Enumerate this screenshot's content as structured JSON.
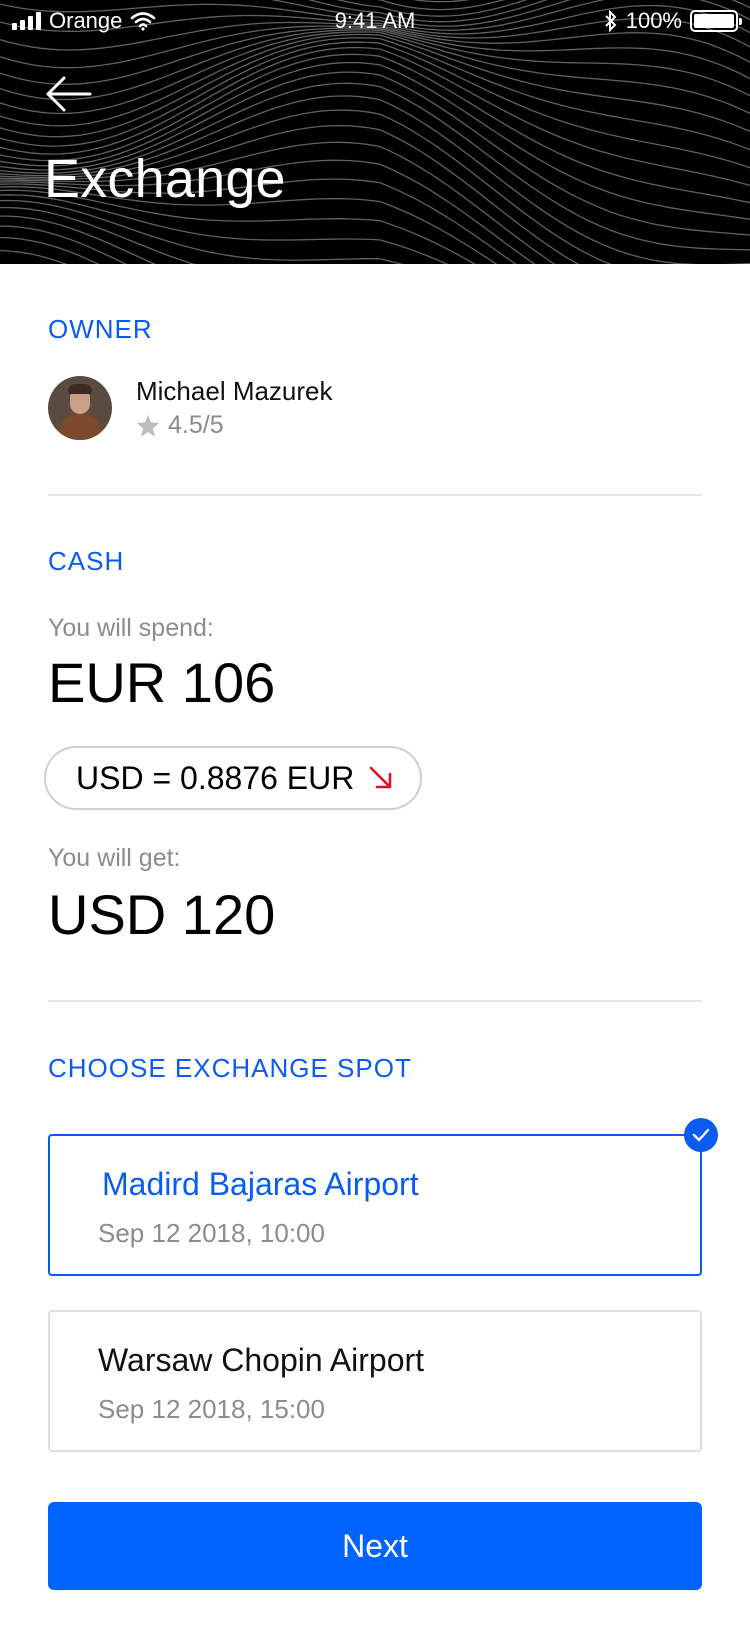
{
  "status_bar": {
    "carrier": "Orange",
    "time": "9:41 AM",
    "battery": "100%"
  },
  "header": {
    "title": "Exchange"
  },
  "owner_section": {
    "label": "OWNER",
    "name": "Michael Mazurek",
    "rating": "4.5/5"
  },
  "cash_section": {
    "label": "CASH",
    "spend_label": "You will spend:",
    "spend_amount": "EUR 106",
    "rate": "USD = 0.8876 EUR",
    "rate_trend_color": "#e0102a",
    "get_label": "You will get:",
    "get_amount": "USD 120"
  },
  "spot_section": {
    "label": "CHOOSE EXCHANGE SPOT",
    "spots": [
      {
        "name": "Madird Bajaras Airport",
        "time": "Sep 12 2018, 10:00",
        "selected": true
      },
      {
        "name": "Warsaw Chopin Airport",
        "time": "Sep 12 2018, 15:00",
        "selected": false
      }
    ]
  },
  "next_button": "Next",
  "colors": {
    "accent": "#0a5cf0",
    "button": "#0063ff"
  }
}
